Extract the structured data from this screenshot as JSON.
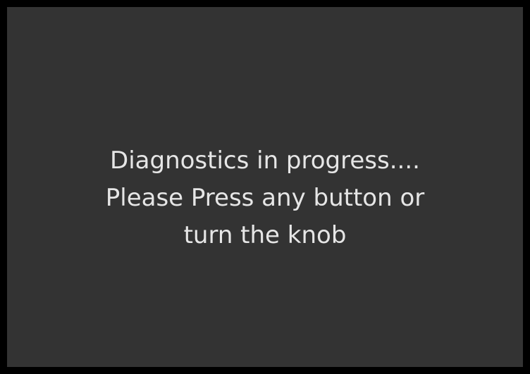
{
  "screen": {
    "message_lines": [
      "Diagnostics in progress....",
      "Please Press any button or",
      "turn the knob"
    ]
  },
  "colors": {
    "frame": "#000000",
    "screen_background": "#333333",
    "text": "#e6e6e6"
  }
}
